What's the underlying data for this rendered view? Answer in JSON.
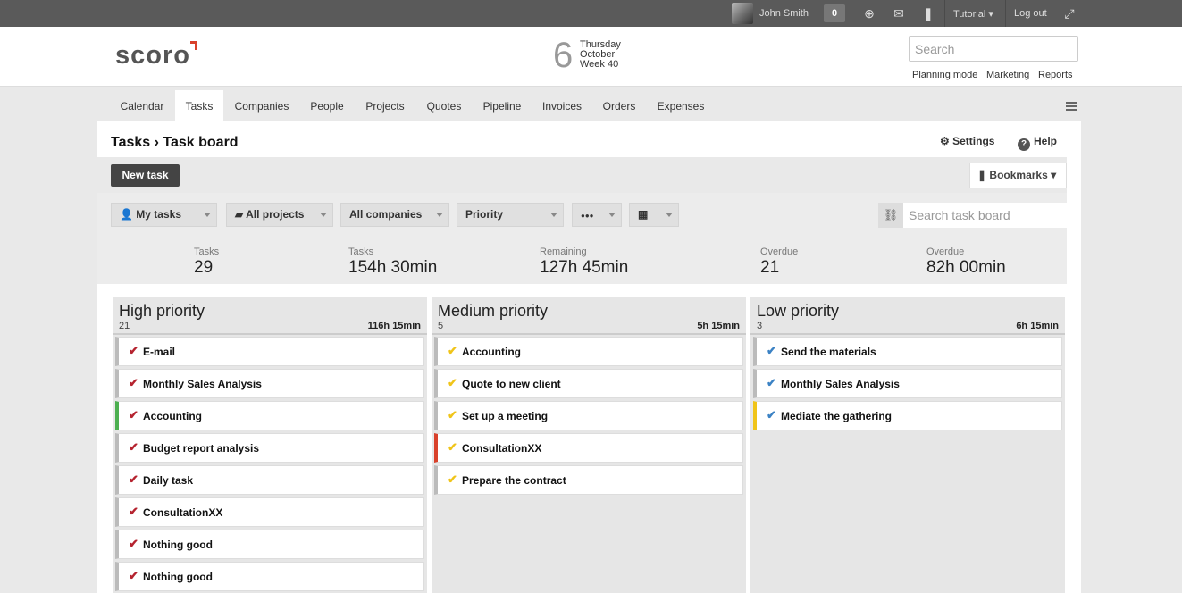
{
  "topbar": {
    "user_name": "John Smith",
    "notification_count": "0",
    "tutorial": "Tutorial ▾",
    "logout": "Log out"
  },
  "header": {
    "logo": "scoro",
    "date_day": "6",
    "date_weekday": "Thursday",
    "date_month": "October",
    "date_week": "Week 40",
    "search_placeholder": "Search",
    "links": [
      "Planning mode",
      "Marketing",
      "Reports"
    ]
  },
  "nav": {
    "tabs": [
      "Calendar",
      "Tasks",
      "Companies",
      "People",
      "Projects",
      "Quotes",
      "Pipeline",
      "Invoices",
      "Orders",
      "Expenses"
    ],
    "active": "Tasks"
  },
  "page": {
    "title": "Tasks › Task board",
    "settings": "Settings",
    "help": "Help",
    "new_task": "New task",
    "bookmarks": "Bookmarks ▾",
    "filters": {
      "my_tasks": "My tasks",
      "all_projects": "All projects",
      "all_companies": "All companies",
      "priority": "Priority",
      "more": "●●●"
    },
    "search_board_placeholder": "Search task board"
  },
  "stats": [
    {
      "label": "Tasks",
      "value": "29"
    },
    {
      "label": "Tasks",
      "value": "154h 30min"
    },
    {
      "label": "Remaining",
      "value": "127h 45min"
    },
    {
      "label": "Overdue",
      "value": "21"
    },
    {
      "label": "Overdue",
      "value": "82h 00min"
    }
  ],
  "columns": [
    {
      "name": "High priority",
      "count": "21",
      "time": "116h 15min",
      "check_color": "#b5232f",
      "cards": [
        {
          "title": "E-mail",
          "bar": "#bbbbbb"
        },
        {
          "title": "Monthly Sales Analysis",
          "bar": "#bbbbbb"
        },
        {
          "title": "Accounting",
          "bar": "#4caf50"
        },
        {
          "title": "Budget report analysis",
          "bar": "#bbbbbb"
        },
        {
          "title": "Daily task",
          "bar": "#bbbbbb"
        },
        {
          "title": "ConsultationXX",
          "bar": "#bbbbbb"
        },
        {
          "title": "Nothing good",
          "bar": "#bbbbbb"
        },
        {
          "title": "Nothing good",
          "bar": "#bbbbbb"
        }
      ]
    },
    {
      "name": "Medium priority",
      "count": "5",
      "time": "5h 15min",
      "check_color": "#f0c419",
      "cards": [
        {
          "title": "Accounting",
          "bar": "#bbbbbb"
        },
        {
          "title": "Quote to new client",
          "bar": "#bbbbbb"
        },
        {
          "title": "Set up a meeting",
          "bar": "#bbbbbb"
        },
        {
          "title": "ConsultationXX",
          "bar": "#d9412b"
        },
        {
          "title": "Prepare the contract",
          "bar": "#bbbbbb"
        }
      ]
    },
    {
      "name": "Low priority",
      "count": "3",
      "time": "6h 15min",
      "check_color": "#3b82c4",
      "cards": [
        {
          "title": "Send the materials",
          "bar": "#bbbbbb"
        },
        {
          "title": "Monthly Sales Analysis",
          "bar": "#bbbbbb"
        },
        {
          "title": "Mediate the gathering",
          "bar": "#f0c419"
        }
      ]
    }
  ]
}
